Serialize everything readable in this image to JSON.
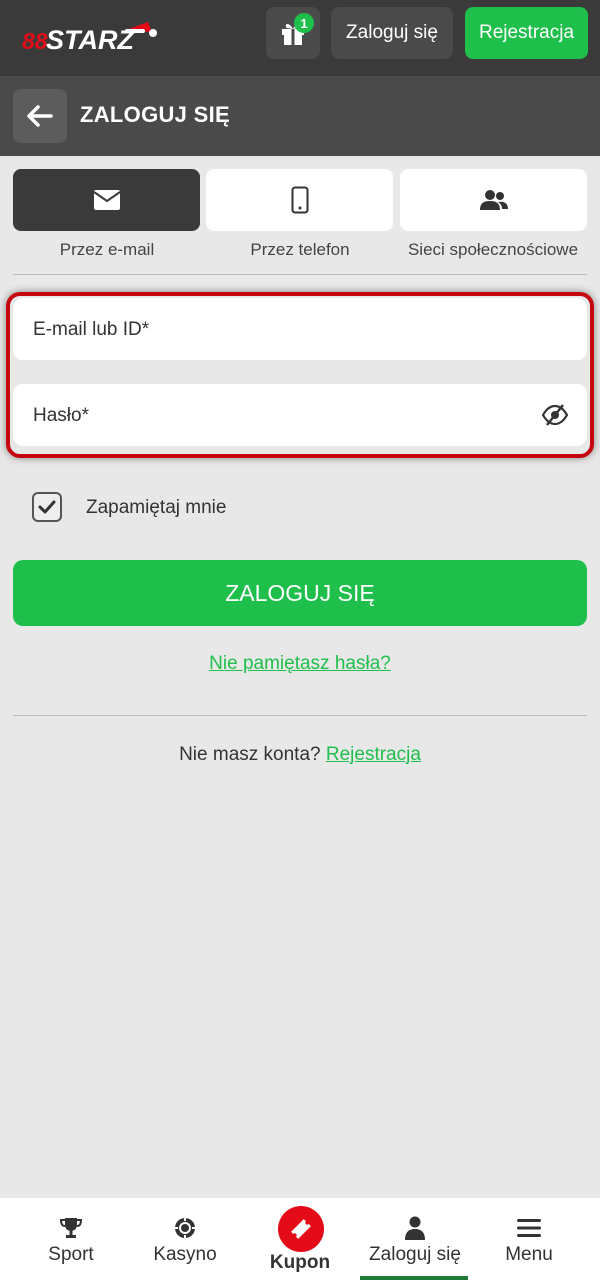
{
  "brand": {
    "name": "STARZ",
    "prefix": "888",
    "accent": "#1fbf4c",
    "logo_red": "#e30b17"
  },
  "topbar": {
    "gift_badge": "1",
    "login_label": "Zaloguj się",
    "register_label": "Rejestracja"
  },
  "subheader": {
    "title": "ZALOGUJ SIĘ"
  },
  "methods": [
    {
      "label": "Przez e-mail",
      "icon": "envelope-icon",
      "active": true
    },
    {
      "label": "Przez telefon",
      "icon": "phone-icon",
      "active": false
    },
    {
      "label": "Sieci społecznościowe",
      "icon": "users-icon",
      "active": false
    }
  ],
  "form": {
    "email_placeholder": "E-mail lub ID*",
    "password_placeholder": "Hasło*",
    "remember_label": "Zapamiętaj mnie",
    "remember_checked": true,
    "submit_label": "ZALOGUJ SIĘ",
    "forgot_label": "Nie pamiętasz hasła?",
    "no_account_text": "Nie masz konta?",
    "register_link": "Rejestracja"
  },
  "bottomnav": {
    "items": [
      {
        "label": "Sport",
        "icon": "trophy-icon"
      },
      {
        "label": "Kasyno",
        "icon": "casino-chip-icon"
      },
      {
        "label": "Kupon",
        "icon": "ticket-icon"
      },
      {
        "label": "Zaloguj się",
        "icon": "user-icon"
      },
      {
        "label": "Menu",
        "icon": "hamburger-icon"
      }
    ]
  }
}
